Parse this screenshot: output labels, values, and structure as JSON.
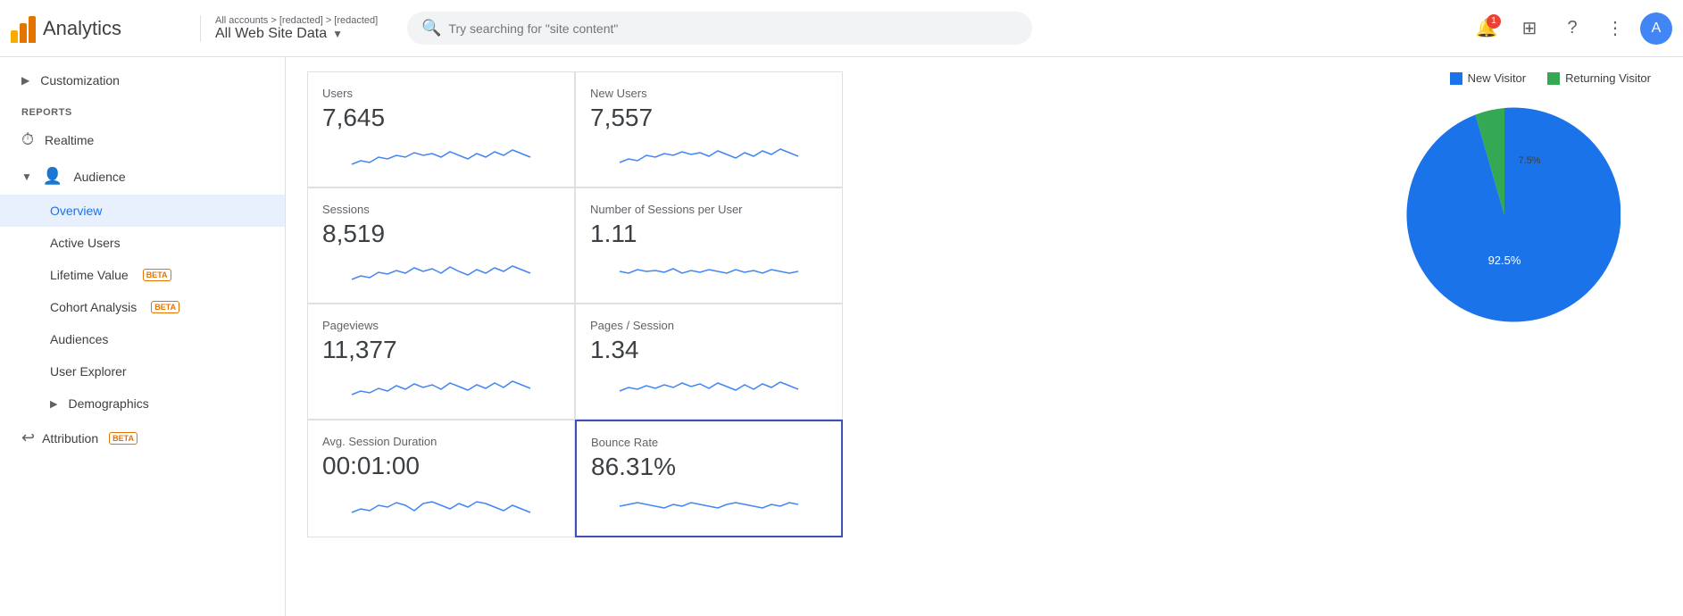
{
  "header": {
    "logo_text": "Analytics",
    "breadcrumb": "All accounts > [redacted] > [redacted]",
    "account_name": "All Web Site Data",
    "search_placeholder": "Try searching for \"site content\"",
    "notification_count": "1"
  },
  "sidebar": {
    "customization_label": "Customization",
    "reports_label": "REPORTS",
    "realtime_label": "Realtime",
    "audience_label": "Audience",
    "overview_label": "Overview",
    "active_users_label": "Active Users",
    "lifetime_value_label": "Lifetime Value",
    "cohort_analysis_label": "Cohort Analysis",
    "audiences_label": "Audiences",
    "user_explorer_label": "User Explorer",
    "demographics_label": "Demographics",
    "attribution_label": "Attribution",
    "beta": "BETA"
  },
  "metrics": [
    {
      "id": "users",
      "label": "Users",
      "value": "7,645",
      "selected": false
    },
    {
      "id": "new_users",
      "label": "New Users",
      "value": "7,557",
      "selected": false
    },
    {
      "id": "sessions",
      "label": "Sessions",
      "value": "8,519",
      "selected": false
    },
    {
      "id": "sessions_per_user",
      "label": "Number of Sessions per User",
      "value": "1.11",
      "selected": false
    },
    {
      "id": "pageviews",
      "label": "Pageviews",
      "value": "11,377",
      "selected": false
    },
    {
      "id": "pages_session",
      "label": "Pages / Session",
      "value": "1.34",
      "selected": false
    },
    {
      "id": "avg_session_duration",
      "label": "Avg. Session Duration",
      "value": "00:01:00",
      "selected": false
    },
    {
      "id": "bounce_rate",
      "label": "Bounce Rate",
      "value": "86.31%",
      "selected": true
    }
  ],
  "chart": {
    "legend": {
      "new_visitor_label": "New Visitor",
      "returning_visitor_label": "Returning Visitor",
      "new_visitor_color": "#1a73e8",
      "returning_visitor_color": "#34a853"
    },
    "new_visitor_pct": "92.5%",
    "returning_visitor_pct": "7.5%",
    "new_visitor_deg": 333,
    "returning_visitor_deg": 27
  }
}
